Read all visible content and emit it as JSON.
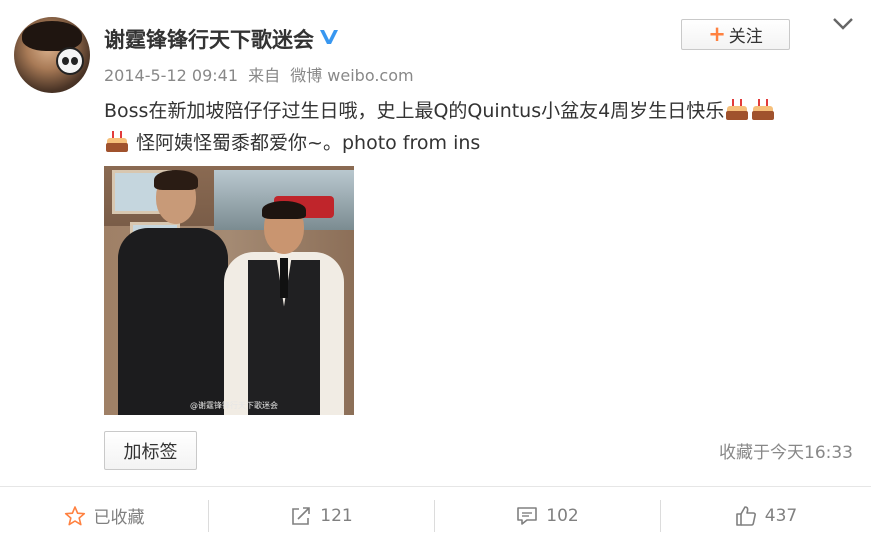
{
  "post": {
    "author": "谢霆锋锋行天下歌迷会",
    "timestamp": "2014-5-12 09:41",
    "source_prefix": "来自",
    "source": "微博 weibo.com",
    "text_line1": "Boss在新加坡陪仔仔过生日哦，史上最Q的Quintus小盆友4周岁生日快乐",
    "text_line2": "怪阿姨怪蜀黍都爱你~。photo from ins",
    "photo_watermark": "@谢霆锋锋行天下歌迷会"
  },
  "header": {
    "follow_label": "关注"
  },
  "tag_button_label": "加标签",
  "favorited_time": "收藏于今天16:33",
  "footer": {
    "favorite_label": "已收藏",
    "repost_count": "121",
    "comment_count": "102",
    "like_count": "437"
  },
  "colors": {
    "accent_orange": "#ff8140",
    "verified_blue": "#3897f0",
    "muted_text": "#808080"
  },
  "icons": {
    "verified": "verified-v-icon",
    "more": "chevron-down-icon",
    "favorite": "star-icon",
    "repost": "repost-icon",
    "comment": "comment-icon",
    "like": "thumbs-up-icon"
  }
}
